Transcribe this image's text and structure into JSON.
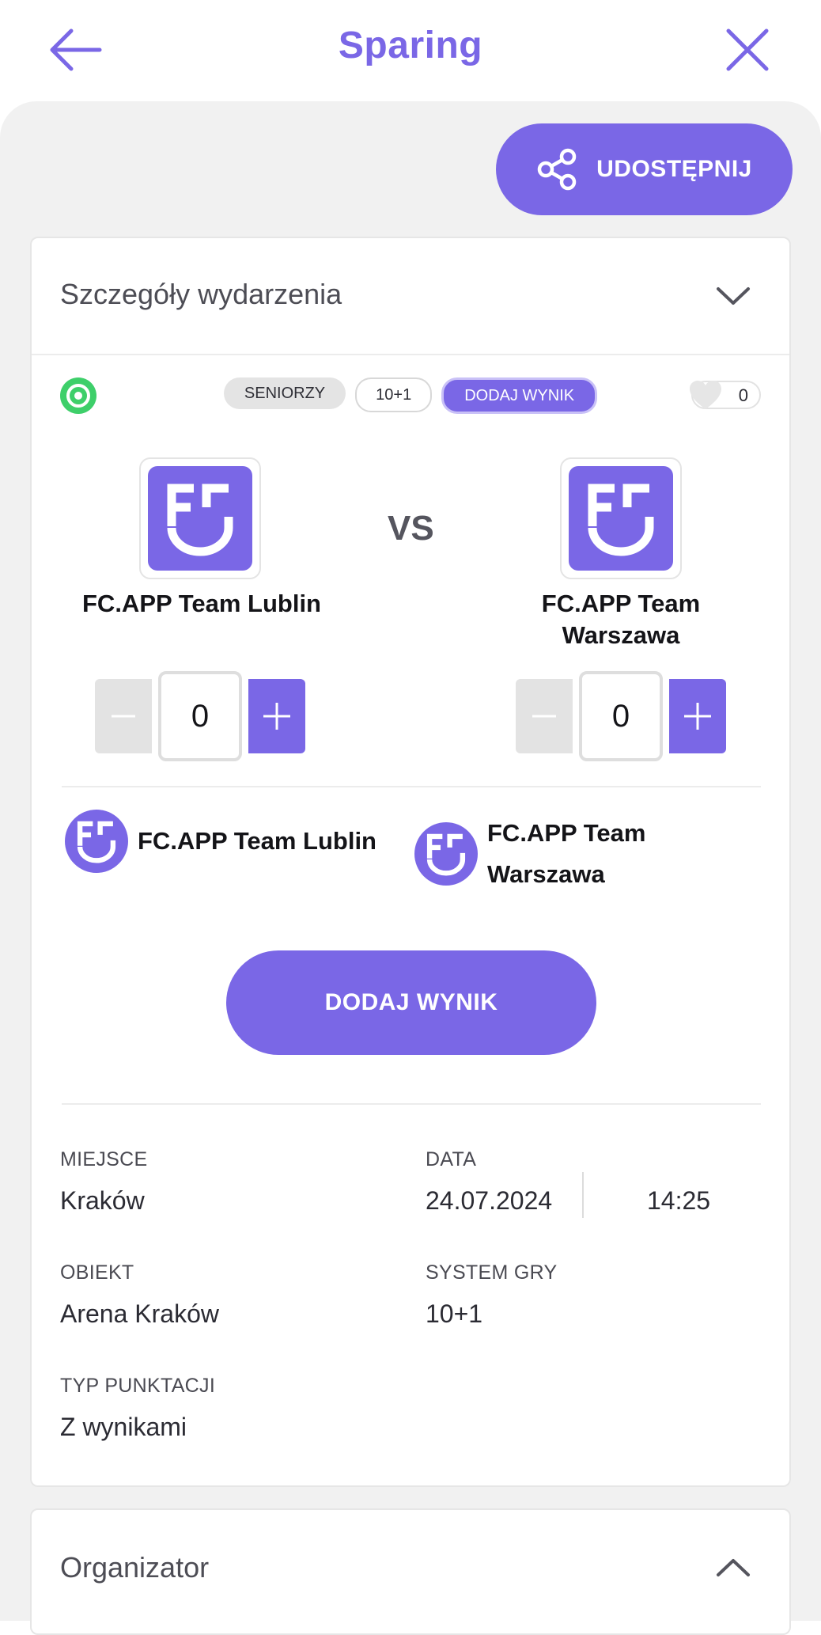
{
  "header": {
    "title": "Sparing"
  },
  "share": {
    "label": "UDOSTĘPNIJ"
  },
  "details": {
    "section_title": "Szczegóły wydarzenia",
    "chips": [
      "SENIORZY",
      "10+1",
      "DODAJ WYNIK"
    ],
    "likes": "0",
    "vs": "VS",
    "home_team": {
      "name": "FC.APP Team Lublin",
      "score": "0"
    },
    "away_team": {
      "name_line1": "FC.APP Team",
      "name_line2": "Warszawa",
      "score": "0"
    },
    "add_result_label": "DODAJ WYNIK",
    "info": {
      "place_label": "MIEJSCE",
      "place_value": "Kraków",
      "date_label": "DATA",
      "date_value": "24.07.2024",
      "time_value": "14:25",
      "venue_label": "OBIEKT",
      "venue_value": "Arena Kraków",
      "system_label": "SYSTEM GRY",
      "system_value": "10+1",
      "scoring_label": "TYP PUNKTACJI",
      "scoring_value": "Z wynikami"
    }
  },
  "organizer": {
    "section_title": "Organizator"
  },
  "colors": {
    "accent": "#7a67e6",
    "background": "#f1f1f1",
    "ball_green": "#3ecf6a"
  },
  "icons": [
    "back-arrow-icon",
    "close-icon",
    "share-icon",
    "chevron-down-icon",
    "chevron-up-icon",
    "soccer-ball-icon",
    "heart-icon",
    "minus-icon",
    "plus-icon",
    "fc-app-logo"
  ]
}
